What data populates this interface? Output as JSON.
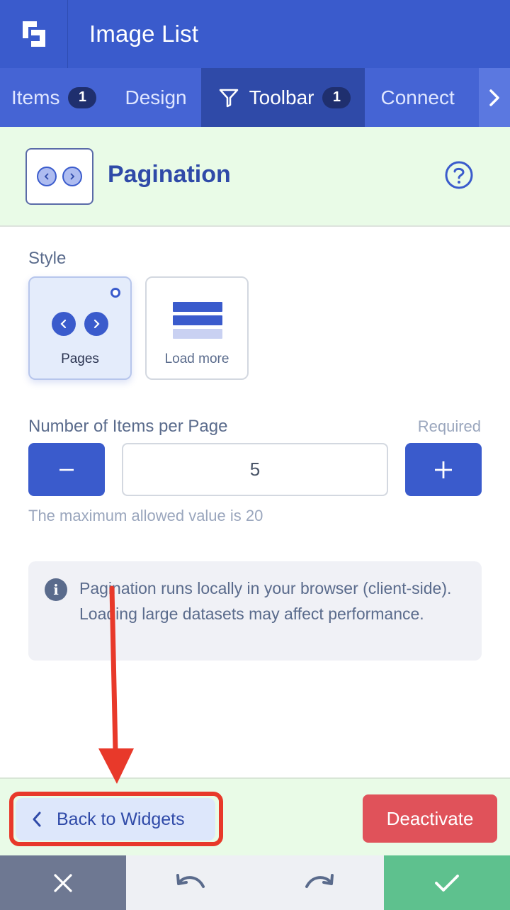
{
  "header": {
    "title": "Image List"
  },
  "tabs": [
    {
      "label": "Items",
      "badge": "1"
    },
    {
      "label": "Design"
    },
    {
      "label": "Toolbar",
      "badge": "1"
    },
    {
      "label": "Connect"
    }
  ],
  "widget": {
    "title": "Pagination"
  },
  "style": {
    "label": "Style",
    "options": [
      {
        "label": "Pages",
        "selected": true
      },
      {
        "label": "Load more",
        "selected": false
      }
    ]
  },
  "items_per_page": {
    "label": "Number of Items per Page",
    "required": "Required",
    "value": "5",
    "hint": "The maximum allowed value is 20"
  },
  "info": {
    "text": "Pagination runs locally in your browser (client-side). Loading large datasets may affect performance."
  },
  "footer": {
    "back_label": "Back to Widgets",
    "deactivate_label": "Deactivate"
  },
  "colors": {
    "primary": "#3a5bcc",
    "active_tab": "#2f4aa8",
    "strip_bg": "#e9fbe7",
    "danger": "#e0525a",
    "success": "#5ec18e",
    "annotation": "#e8392a"
  },
  "icons": {
    "logo": "logo-icon",
    "tab_toolbar": "filter-icon",
    "tab_scroll": "chevron-right-icon",
    "help": "help-icon",
    "info": "info-icon",
    "back": "chevron-left-icon",
    "close": "close-icon",
    "undo": "undo-icon",
    "redo": "redo-icon",
    "confirm": "check-icon"
  }
}
